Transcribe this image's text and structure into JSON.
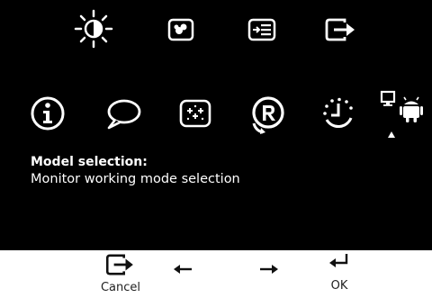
{
  "osd": {
    "menu_items": [
      {
        "icon": "brightness-icon"
      },
      {
        "icon": "image-properties-icon"
      },
      {
        "icon": "input-signal-icon"
      },
      {
        "icon": "exit-icon"
      },
      {
        "icon": "information-icon"
      },
      {
        "icon": "language-icon"
      },
      {
        "icon": "menu-settings-icon"
      },
      {
        "icon": "factory-reset-icon"
      },
      {
        "icon": "power-timer-icon"
      },
      {
        "icon": "model-selection-icon"
      }
    ],
    "description": {
      "title": "Model selection:",
      "text": "Monitor working mode selection"
    }
  },
  "controls": {
    "cancel_label": "Cancel",
    "ok_label": "OK"
  },
  "colors": {
    "osd_background": "#000000",
    "icon_color": "#ffffff",
    "page_background": "#ffffff",
    "control_icon_color": "#111111"
  }
}
